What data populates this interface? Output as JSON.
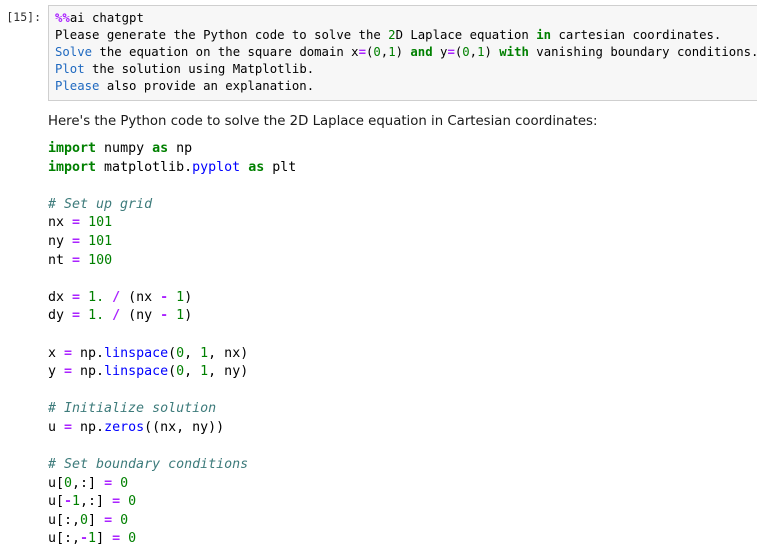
{
  "cell": {
    "prompt_label": "[15]:",
    "input_lines": [
      [
        {
          "t": "%%",
          "c": "cp"
        },
        {
          "t": "ai chatgpt",
          "c": "n"
        }
      ],
      [
        {
          "t": "Please generate the Python code to solve the ",
          "c": "n"
        },
        {
          "t": "2",
          "c": "m"
        },
        {
          "t": "D Laplace equation ",
          "c": "n"
        },
        {
          "t": "in",
          "c": "k"
        },
        {
          "t": " cartesian coordinates.",
          "c": "n"
        }
      ],
      [
        {
          "t": "Solve",
          "c": "nb"
        },
        {
          "t": " the equation on the square domain x",
          "c": "n"
        },
        {
          "t": "=",
          "c": "o"
        },
        {
          "t": "(",
          "c": "p"
        },
        {
          "t": "0",
          "c": "m"
        },
        {
          "t": ",",
          "c": "p"
        },
        {
          "t": "1",
          "c": "m"
        },
        {
          "t": ") ",
          "c": "p"
        },
        {
          "t": "and",
          "c": "k"
        },
        {
          "t": " y",
          "c": "n"
        },
        {
          "t": "=",
          "c": "o"
        },
        {
          "t": "(",
          "c": "p"
        },
        {
          "t": "0",
          "c": "m"
        },
        {
          "t": ",",
          "c": "p"
        },
        {
          "t": "1",
          "c": "m"
        },
        {
          "t": ") ",
          "c": "p"
        },
        {
          "t": "with",
          "c": "k"
        },
        {
          "t": " vanishing boundary conditions.",
          "c": "n"
        }
      ],
      [
        {
          "t": "Plot",
          "c": "nb"
        },
        {
          "t": " the solution using Matplotlib.",
          "c": "n"
        }
      ],
      [
        {
          "t": "Please",
          "c": "nb"
        },
        {
          "t": " also provide an explanation.",
          "c": "n"
        }
      ]
    ],
    "output_intro": "Here's the Python code to solve the 2D Laplace equation in Cartesian coordinates:",
    "output_code_lines": [
      [
        {
          "t": "import",
          "c": "k"
        },
        {
          "t": " numpy ",
          "c": "n"
        },
        {
          "t": "as",
          "c": "k"
        },
        {
          "t": " np",
          "c": "n"
        }
      ],
      [
        {
          "t": "import",
          "c": "k"
        },
        {
          "t": " matplotlib.",
          "c": "n"
        },
        {
          "t": "pyplot",
          "c": "nf"
        },
        {
          "t": " ",
          "c": "n"
        },
        {
          "t": "as",
          "c": "k"
        },
        {
          "t": " plt",
          "c": "n"
        }
      ],
      [],
      [
        {
          "t": "# Set up grid",
          "c": "c"
        }
      ],
      [
        {
          "t": "nx ",
          "c": "n"
        },
        {
          "t": "=",
          "c": "o"
        },
        {
          "t": " ",
          "c": "n"
        },
        {
          "t": "101",
          "c": "m"
        }
      ],
      [
        {
          "t": "ny ",
          "c": "n"
        },
        {
          "t": "=",
          "c": "o"
        },
        {
          "t": " ",
          "c": "n"
        },
        {
          "t": "101",
          "c": "m"
        }
      ],
      [
        {
          "t": "nt ",
          "c": "n"
        },
        {
          "t": "=",
          "c": "o"
        },
        {
          "t": " ",
          "c": "n"
        },
        {
          "t": "100",
          "c": "m"
        }
      ],
      [],
      [
        {
          "t": "dx ",
          "c": "n"
        },
        {
          "t": "=",
          "c": "o"
        },
        {
          "t": " ",
          "c": "n"
        },
        {
          "t": "1.",
          "c": "m"
        },
        {
          "t": " ",
          "c": "n"
        },
        {
          "t": "/",
          "c": "o"
        },
        {
          "t": " (nx ",
          "c": "n"
        },
        {
          "t": "-",
          "c": "o"
        },
        {
          "t": " ",
          "c": "n"
        },
        {
          "t": "1",
          "c": "m"
        },
        {
          "t": ")",
          "c": "p"
        }
      ],
      [
        {
          "t": "dy ",
          "c": "n"
        },
        {
          "t": "=",
          "c": "o"
        },
        {
          "t": " ",
          "c": "n"
        },
        {
          "t": "1.",
          "c": "m"
        },
        {
          "t": " ",
          "c": "n"
        },
        {
          "t": "/",
          "c": "o"
        },
        {
          "t": " (ny ",
          "c": "n"
        },
        {
          "t": "-",
          "c": "o"
        },
        {
          "t": " ",
          "c": "n"
        },
        {
          "t": "1",
          "c": "m"
        },
        {
          "t": ")",
          "c": "p"
        }
      ],
      [],
      [
        {
          "t": "x ",
          "c": "n"
        },
        {
          "t": "=",
          "c": "o"
        },
        {
          "t": " np.",
          "c": "n"
        },
        {
          "t": "linspace",
          "c": "nf"
        },
        {
          "t": "(",
          "c": "p"
        },
        {
          "t": "0",
          "c": "m"
        },
        {
          "t": ", ",
          "c": "p"
        },
        {
          "t": "1",
          "c": "m"
        },
        {
          "t": ", nx)",
          "c": "p"
        }
      ],
      [
        {
          "t": "y ",
          "c": "n"
        },
        {
          "t": "=",
          "c": "o"
        },
        {
          "t": " np.",
          "c": "n"
        },
        {
          "t": "linspace",
          "c": "nf"
        },
        {
          "t": "(",
          "c": "p"
        },
        {
          "t": "0",
          "c": "m"
        },
        {
          "t": ", ",
          "c": "p"
        },
        {
          "t": "1",
          "c": "m"
        },
        {
          "t": ", ny)",
          "c": "p"
        }
      ],
      [],
      [
        {
          "t": "# Initialize solution",
          "c": "c"
        }
      ],
      [
        {
          "t": "u ",
          "c": "n"
        },
        {
          "t": "=",
          "c": "o"
        },
        {
          "t": " np.",
          "c": "n"
        },
        {
          "t": "zeros",
          "c": "nf"
        },
        {
          "t": "((nx, ny))",
          "c": "p"
        }
      ],
      [],
      [
        {
          "t": "# Set boundary conditions",
          "c": "c"
        }
      ],
      [
        {
          "t": "u[",
          "c": "n"
        },
        {
          "t": "0",
          "c": "m"
        },
        {
          "t": ",:] ",
          "c": "p"
        },
        {
          "t": "=",
          "c": "o"
        },
        {
          "t": " ",
          "c": "n"
        },
        {
          "t": "0",
          "c": "m"
        }
      ],
      [
        {
          "t": "u[",
          "c": "n"
        },
        {
          "t": "-",
          "c": "o"
        },
        {
          "t": "1",
          "c": "m"
        },
        {
          "t": ",:] ",
          "c": "p"
        },
        {
          "t": "=",
          "c": "o"
        },
        {
          "t": " ",
          "c": "n"
        },
        {
          "t": "0",
          "c": "m"
        }
      ],
      [
        {
          "t": "u[:,",
          "c": "n"
        },
        {
          "t": "0",
          "c": "m"
        },
        {
          "t": "] ",
          "c": "p"
        },
        {
          "t": "=",
          "c": "o"
        },
        {
          "t": " ",
          "c": "n"
        },
        {
          "t": "0",
          "c": "m"
        }
      ],
      [
        {
          "t": "u[:,",
          "c": "n"
        },
        {
          "t": "-",
          "c": "o"
        },
        {
          "t": "1",
          "c": "m"
        },
        {
          "t": "] ",
          "c": "p"
        },
        {
          "t": "=",
          "c": "o"
        },
        {
          "t": " ",
          "c": "n"
        },
        {
          "t": "0",
          "c": "m"
        }
      ]
    ]
  },
  "colors": {
    "keyword": "#008000",
    "number": "#008000",
    "operator": "#aa22ff",
    "comment": "#3d7b7b",
    "function": "#0000ff",
    "builtin": "#1f69c0",
    "magic": "#aa22ff",
    "input_background": "#f7f7f7",
    "input_border": "#cfcfcf",
    "page_background": "#ffffff"
  }
}
